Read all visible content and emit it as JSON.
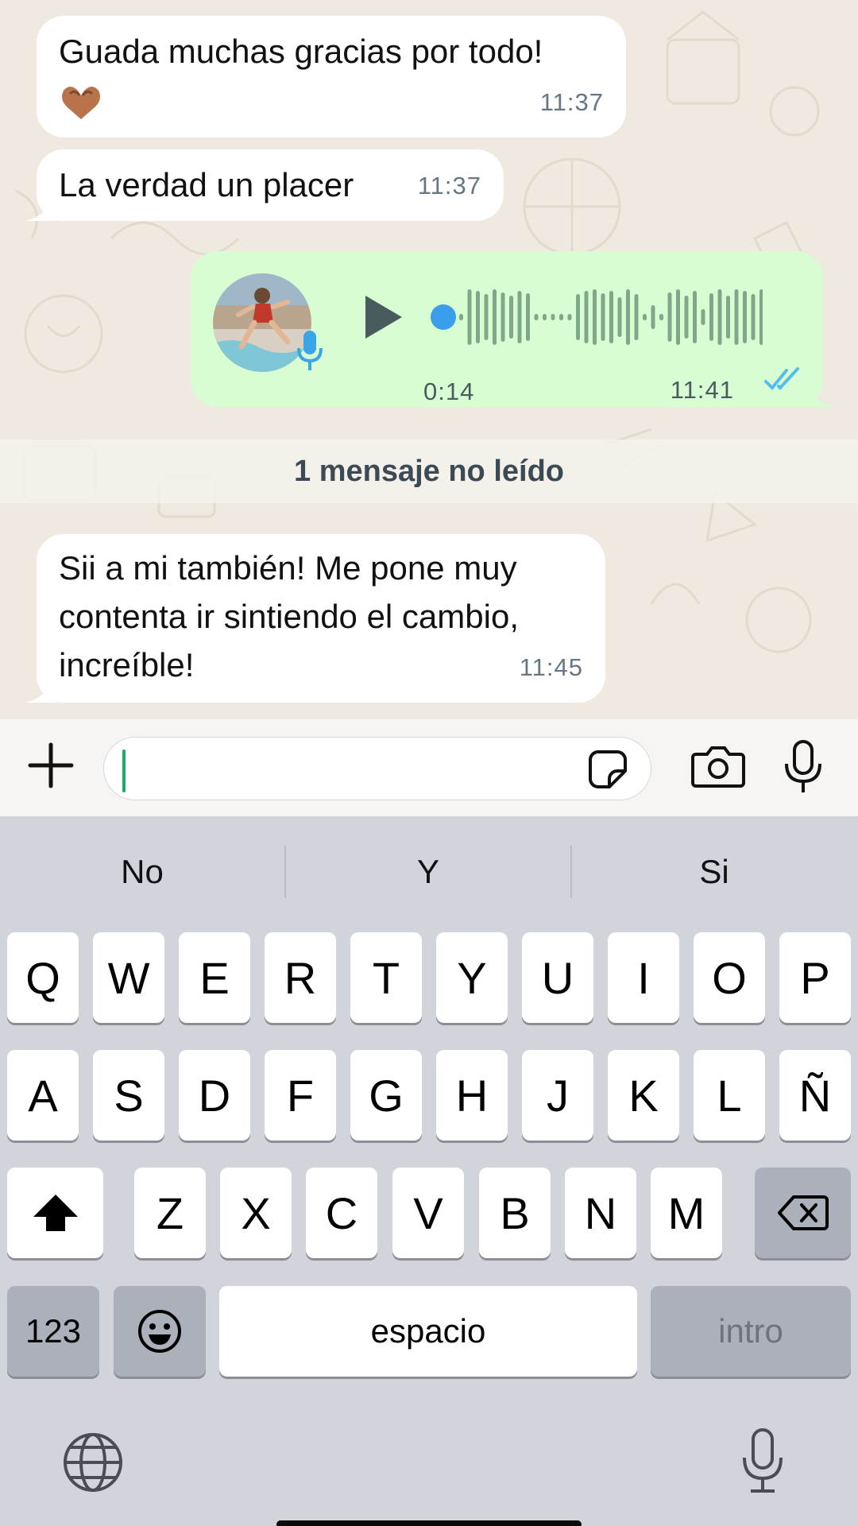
{
  "messages": [
    {
      "text": "Guada muchas gracias por todo!",
      "emoji": "🫶🏼",
      "time": "11:37",
      "direction": "incoming"
    },
    {
      "text": "La verdad un placer",
      "time": "11:37",
      "direction": "incoming"
    },
    {
      "type": "voice",
      "duration": "0:14",
      "time": "11:41",
      "direction": "outgoing",
      "status": "read"
    },
    {
      "lines": [
        "Sii a mi también! Me pone muy",
        "contenta ir sintiendo el cambio,",
        "increíble!"
      ],
      "time": "11:45",
      "direction": "incoming"
    }
  ],
  "unread_banner": "1 mensaje no leído",
  "composer": {
    "placeholder": ""
  },
  "keyboard": {
    "suggestions": [
      "No",
      "Y",
      "Si"
    ],
    "rows": [
      [
        "Q",
        "W",
        "E",
        "R",
        "T",
        "Y",
        "U",
        "I",
        "O",
        "P"
      ],
      [
        "A",
        "S",
        "D",
        "F",
        "G",
        "H",
        "J",
        "K",
        "L",
        "Ñ"
      ],
      [
        "Z",
        "X",
        "C",
        "V",
        "B",
        "N",
        "M"
      ]
    ],
    "numbers_key": "123",
    "space_key": "espacio",
    "return_key": "intro"
  },
  "colors": {
    "chat_bg": "#efe9df",
    "incoming_bubble": "#ffffff",
    "outgoing_bubble": "#d9fdd3",
    "read_ticks": "#53bdeb",
    "accent_green": "#1daa61",
    "keyboard_bg": "#d1d4da"
  },
  "icons": [
    "plus-icon",
    "sticker-icon",
    "camera-icon",
    "microphone-icon",
    "play-icon",
    "double-check-icon",
    "shift-icon",
    "backspace-icon",
    "emoji-icon",
    "globe-icon",
    "dictation-icon"
  ]
}
